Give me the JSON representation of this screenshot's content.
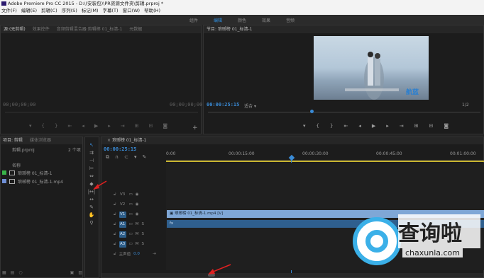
{
  "app": {
    "title": "Adobe Premiere Pro CC 2015 - D:\\(安装包)\\PR资源文件夹\\剪辑.prproj *"
  },
  "menu": [
    "文件(F)",
    "编辑(E)",
    "剪辑(C)",
    "序列(S)",
    "标记(M)",
    "字幕(T)",
    "窗口(W)",
    "帮助(H)"
  ],
  "workspaces": {
    "items": [
      "组件",
      "编辑",
      "颜色",
      "效果",
      "音频"
    ],
    "active_index": 1
  },
  "source": {
    "tabs": [
      "源:(无剪辑)",
      "效果控件",
      "音频剪辑混合器:剪辑棒 01_标清-1",
      "元数据"
    ],
    "timecode_left": "00;00;00;00",
    "timecode_right": "00;00;00;00"
  },
  "program": {
    "tab": "节目: 琅琊榜 01_标清-1",
    "timecode": "00:00:25:15",
    "fit": "适合",
    "page": "1/2",
    "watermark": "航蓝",
    "video_subtitle": "..."
  },
  "project": {
    "tabs": [
      "项目: 剪辑",
      "媒体浏览器"
    ],
    "filename": "剪辑.prproj",
    "count": "2 个项",
    "column_header": "名称",
    "items": [
      {
        "name": "琅琊榜 01_标清-1",
        "color": "#39b449"
      },
      {
        "name": "琅琊榜 01_标清-1.mp4",
        "color": "#6f8fd6"
      }
    ]
  },
  "timeline": {
    "tab": "琅琊榜 01_标清-1",
    "timecode": "00:00:25:15",
    "ruler": [
      "0:00",
      "00:00:15:00",
      "00:00:30:00",
      "00:00:45:00",
      "00:01:00:00"
    ],
    "video_tracks": [
      "V3",
      "V2",
      "V1"
    ],
    "audio_tracks": [
      "A1",
      "A2",
      "A3"
    ],
    "master_label": "主声道",
    "master_value": "0.0",
    "video_clip": "琅琊榜 01_标清-1.mp4 [V]",
    "audio_clip": "fx",
    "mute": "M",
    "solo": "S"
  },
  "watermark": {
    "text": "查询啦",
    "url": "chaxunla.com",
    "accent": "#3bb0e8"
  },
  "colors": {
    "accent": "#2f8fe0",
    "clip_video": "#7fa7d6",
    "clip_audio": "#2f5f8e",
    "playhead": "#3a8bd6",
    "arrow": "#e02020"
  }
}
